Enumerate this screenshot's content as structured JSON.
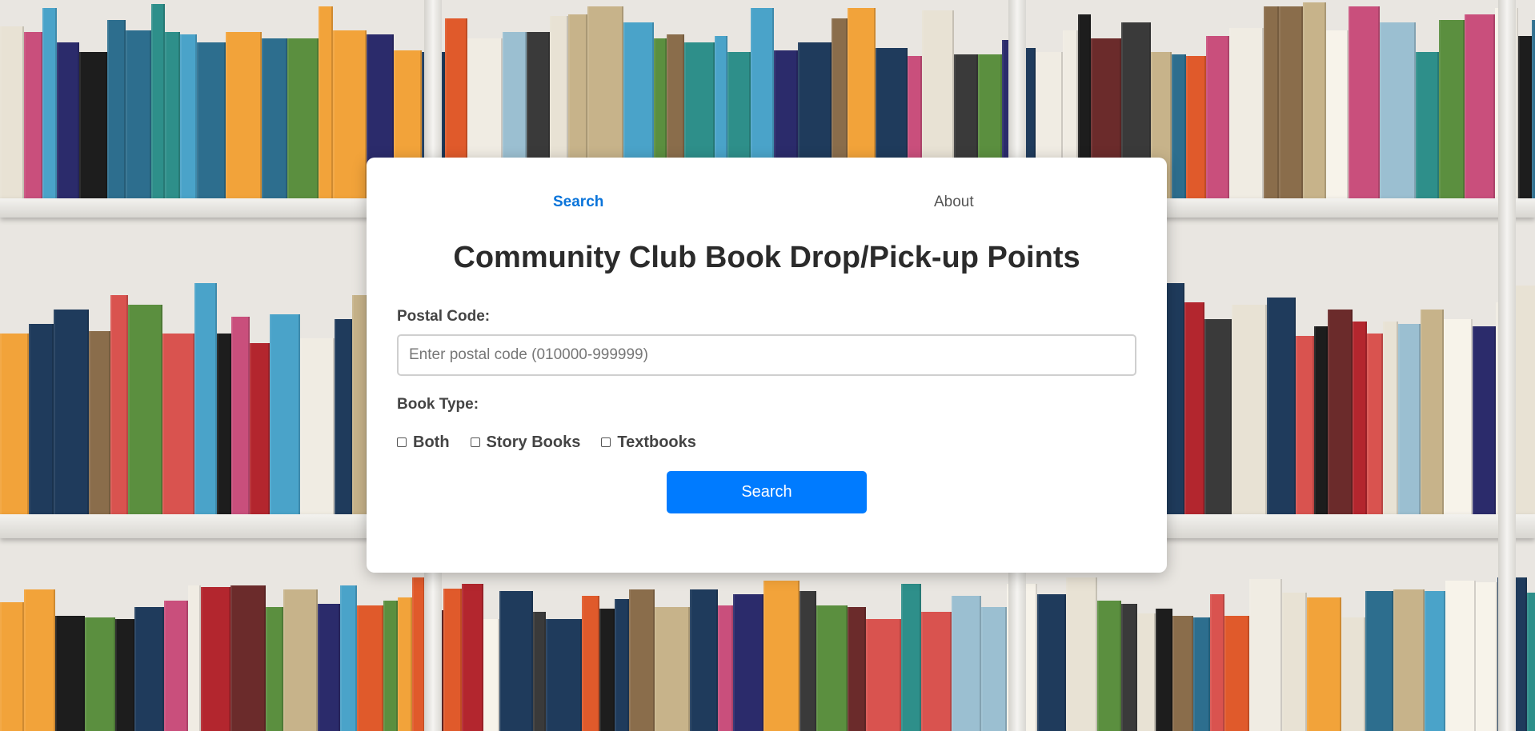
{
  "nav": {
    "tabs": [
      {
        "label": "Search",
        "active": true
      },
      {
        "label": "About",
        "active": false
      }
    ]
  },
  "form": {
    "title": "Community Club Book Drop/Pick-up Points",
    "postal_code_label": "Postal Code:",
    "postal_code_placeholder": "Enter postal code (010000-999999)",
    "postal_code_value": "",
    "book_type_label": "Book Type:",
    "book_type_options": [
      {
        "label": "Both",
        "checked": false
      },
      {
        "label": "Story Books",
        "checked": false
      },
      {
        "label": "Textbooks",
        "checked": false
      }
    ],
    "search_button_label": "Search"
  },
  "colors": {
    "accent": "#007bff",
    "active_tab": "#0a74da",
    "card": "#ffffff"
  },
  "background_image": "bookshelf-photo"
}
